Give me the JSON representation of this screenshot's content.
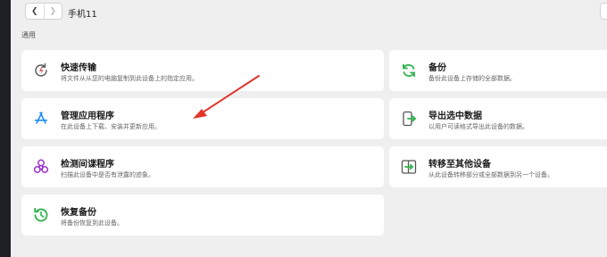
{
  "header": {
    "device_name": "手机11",
    "back_icon": "chevron-left-icon",
    "forward_icon": "chevron-right-icon"
  },
  "section": {
    "title": "通用"
  },
  "cards": [
    {
      "id": "quick-transfer",
      "title": "快速传输",
      "desc": "将文件从从您的电脑复制到此设备上的指定应用。",
      "icon": "transfer-refresh-icon",
      "icon_color": "#d94a4a"
    },
    {
      "id": "backup",
      "title": "备份",
      "desc": "备份此设备上存储的全部数据。",
      "icon": "backup-cycle-icon",
      "icon_color": "#2fb24c"
    },
    {
      "id": "manage-apps",
      "title": "管理应用程序",
      "desc": "在此设备上下载、安装并更新应用。",
      "icon": "app-store-icon",
      "icon_color": "#1e8ef0"
    },
    {
      "id": "export-data",
      "title": "导出选中数据",
      "desc": "以用户可读格式导出此设备的数据。",
      "icon": "phone-export-icon",
      "icon_color": "#2fb24c"
    },
    {
      "id": "spyware-detect",
      "title": "检测间谍程序",
      "desc": "扫描此设备中是否有泄露的迹象。",
      "icon": "biohazard-icon",
      "icon_color": "#9b2fc9"
    },
    {
      "id": "transfer-device",
      "title": "转移至其他设备",
      "desc": "从此设备转移部分或全部数据到另一个设备。",
      "icon": "phone-transfer-icon",
      "icon_color": "#2fb24c"
    },
    {
      "id": "restore-backup",
      "title": "恢复备份",
      "desc": "将备份恢复到此设备。",
      "icon": "restore-clock-icon",
      "icon_color": "#2fb24c"
    }
  ],
  "annotation": {
    "arrow_color": "#e0362c"
  }
}
